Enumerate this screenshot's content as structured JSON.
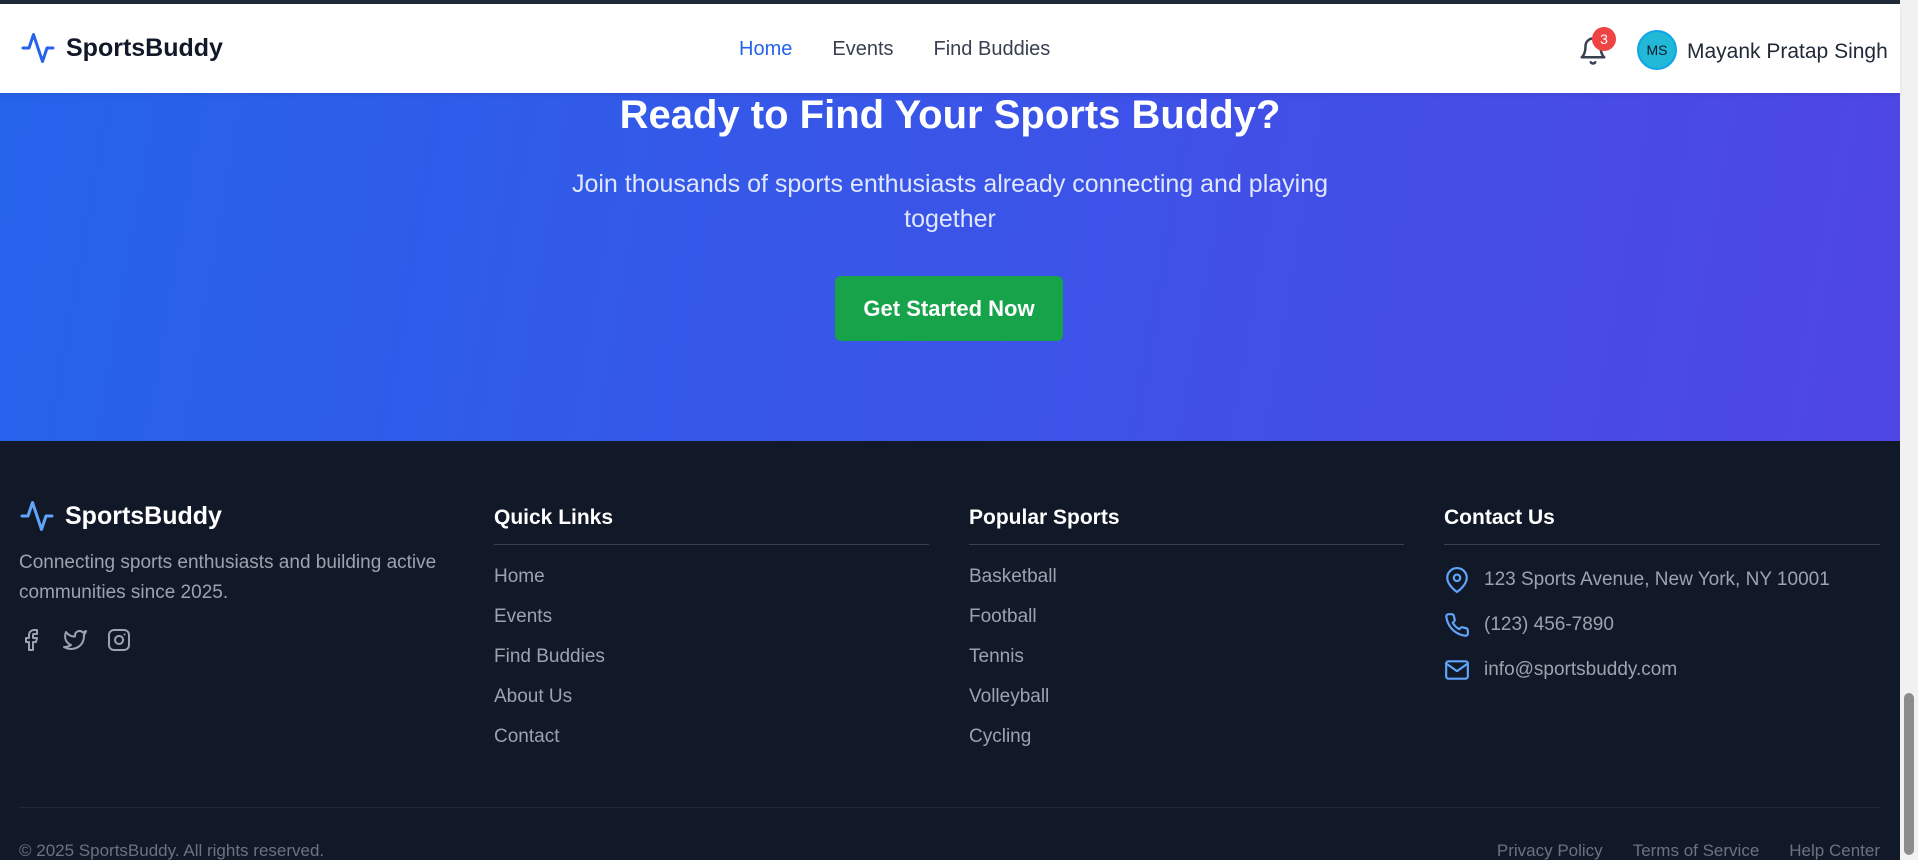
{
  "header": {
    "brand": "SportsBuddy",
    "nav": [
      "Home",
      "Events",
      "Find Buddies"
    ],
    "active_nav": "Home",
    "notification_count": "3",
    "avatar_initials": "MS",
    "user_name": "Mayank Pratap Singh"
  },
  "hero": {
    "title": "Ready to Find Your Sports Buddy?",
    "subtitle": "Join thousands of sports enthusiasts already connecting and playing together",
    "cta_label": "Get Started Now"
  },
  "footer": {
    "brand": "SportsBuddy",
    "tagline": "Connecting sports enthusiasts and building active communities since 2025.",
    "social_icons": [
      "facebook-icon",
      "twitter-icon",
      "instagram-icon"
    ],
    "quick_links": {
      "title": "Quick Links",
      "items": [
        "Home",
        "Events",
        "Find Buddies",
        "About Us",
        "Contact"
      ]
    },
    "popular_sports": {
      "title": "Popular Sports",
      "items": [
        "Basketball",
        "Football",
        "Tennis",
        "Volleyball",
        "Cycling"
      ]
    },
    "contact": {
      "title": "Contact Us",
      "address": "123 Sports Avenue, New York, NY 10001",
      "phone": "(123) 456-7890",
      "email": "info@sportsbuddy.com"
    },
    "copyright": "© 2025 SportsBuddy. All rights reserved.",
    "legal": [
      "Privacy Policy",
      "Terms of Service",
      "Help Center"
    ]
  },
  "colors": {
    "primary": "#2563eb",
    "hero_gradient_end": "#4f46e5",
    "cta": "#16a34a",
    "footer_bg": "#111827",
    "badge": "#ef4444"
  }
}
